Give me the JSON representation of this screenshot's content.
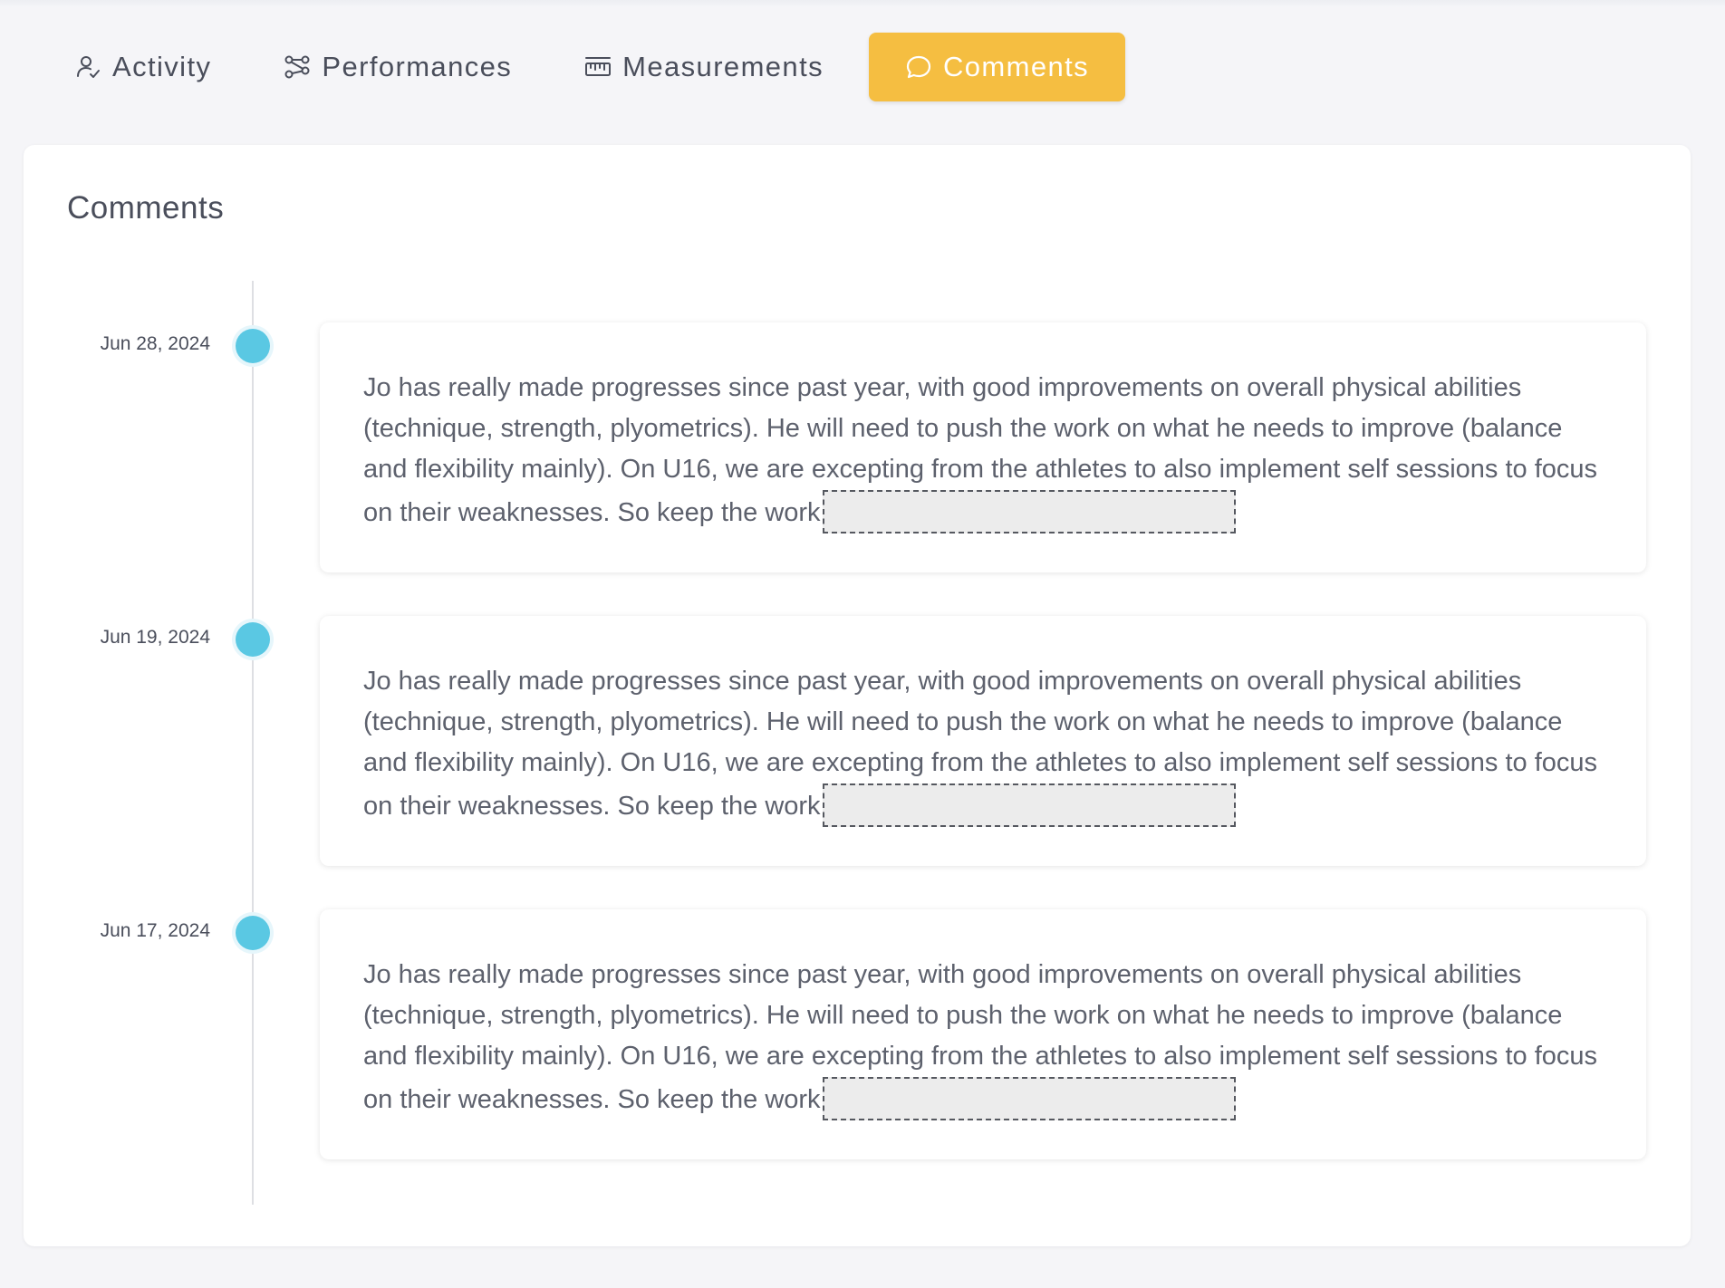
{
  "tabs": [
    {
      "label": "Activity",
      "icon": "user-check-icon",
      "active": false
    },
    {
      "label": "Performances",
      "icon": "nodes-icon",
      "active": false
    },
    {
      "label": "Measurements",
      "icon": "ruler-icon",
      "active": false
    },
    {
      "label": "Comments",
      "icon": "chat-bubble-icon",
      "active": true
    }
  ],
  "colors": {
    "active_tab": "#f5be41",
    "timeline_dot": "#5ac8e3",
    "page_background": "#f5f5f8"
  },
  "comments_section": {
    "title": "Comments",
    "entries": [
      {
        "date": "Jun 28, 2024",
        "text": "Jo has really made progresses since past year, with good improvements on overall physical abilities (technique, strength, plyometrics). He will need to push the work on what he needs to improve (balance and flexibility mainly). On U16, we are excepting from the athletes to also implement self sessions to focus on their weaknesses. So keep the work"
      },
      {
        "date": "Jun 19, 2024",
        "text": "Jo has really made progresses since past year, with good improvements on overall physical abilities (technique, strength, plyometrics). He will need to push the work on what he needs to improve (balance and flexibility mainly). On U16, we are excepting from the athletes to also implement self sessions to focus on their weaknesses. So keep the work"
      },
      {
        "date": "Jun 17, 2024",
        "text": "Jo has really made progresses since past year, with good improvements on overall physical abilities (technique, strength, plyometrics). He will need to push the work on what he needs to improve (balance and flexibility mainly). On U16, we are excepting from the athletes to also implement self sessions to focus on their weaknesses. So keep the work"
      }
    ]
  }
}
